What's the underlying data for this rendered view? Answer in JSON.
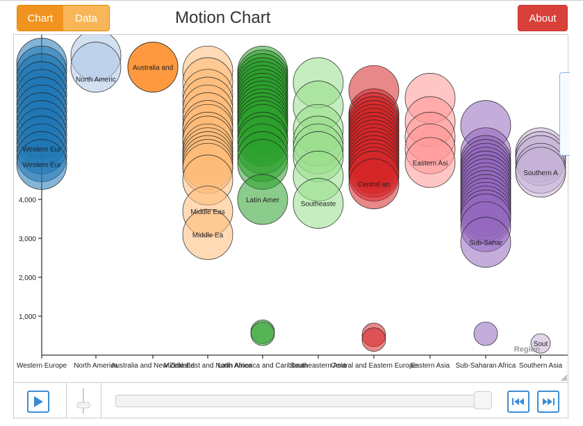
{
  "app": {
    "title": "Motion Chart",
    "tabs": [
      {
        "label": "Chart",
        "active": true
      },
      {
        "label": "Data",
        "active": false
      }
    ],
    "about_label": "About"
  },
  "chart_data": {
    "type": "scatter",
    "title": "",
    "xlabel": "Region",
    "ylabel": "",
    "categories": [
      "Western Europe",
      "North America",
      "Australia and New Zealand",
      "Middle East and North Africa",
      "Latin America and Caribbean",
      "Southeastern Asia",
      "Central and Eastern Europe",
      "Eastern Asia",
      "Sub-Saharan Africa",
      "Southern Asia"
    ],
    "yticks": [
      1000,
      2000,
      3000,
      4000
    ],
    "ylim": [
      0,
      5000
    ],
    "grid": false,
    "legend": "none",
    "colors": {
      "Western Europe": "#1f77b4",
      "North America": "#aec7e8",
      "Australia and New Zealand": "#ff7f0e",
      "Middle East and North Africa": "#ffbb78",
      "Latin America and Caribbean": "#2ca02c",
      "Southeastern Asia": "#98df8a",
      "Central and Eastern Europe": "#d62728",
      "Eastern Asia": "#ff9896",
      "Sub-Saharan Africa": "#9467bd",
      "Southern Asia": "#c5b0d5"
    },
    "series": [
      {
        "region": "Western Europe",
        "label": "Western Eur",
        "values": [
          7500,
          7300,
          7100,
          6900,
          6700,
          6500,
          6300,
          6100,
          5900,
          5700,
          5500,
          5300,
          5100,
          4900
        ]
      },
      {
        "region": "North America",
        "label": "North Americ",
        "values": [
          7700,
          7400
        ]
      },
      {
        "region": "Australia and New Zealand",
        "label": "Australia and",
        "values": [
          7400,
          7400
        ]
      },
      {
        "region": "Middle East and North Africa",
        "label": "Middle Ea",
        "values": [
          7300,
          7000,
          6700,
          6500,
          6300,
          6100,
          5900,
          5800,
          5600,
          5500,
          5300,
          5200,
          5100,
          5000,
          4900,
          4800,
          4500,
          3700,
          3100
        ]
      },
      {
        "region": "Latin America and Caribbean",
        "label": "Latin Amer",
        "values": [
          7300,
          7200,
          7100,
          7000,
          6900,
          6800,
          6700,
          6600,
          6500,
          6400,
          6300,
          6200,
          6100,
          6000,
          5900,
          5800,
          5600,
          5500,
          5300,
          5100,
          4900,
          4000,
          600,
          550
        ]
      },
      {
        "region": "Southeastern Asia",
        "label": "Southeaste",
        "values": [
          7000,
          6400,
          5800,
          5500,
          5300,
          5100,
          4600,
          3900
        ]
      },
      {
        "region": "Central and Eastern Europe",
        "label": "Central an",
        "values": [
          6800,
          6200,
          6100,
          6000,
          5900,
          5800,
          5700,
          5600,
          5500,
          5400,
          5300,
          5200,
          5100,
          5000,
          4900,
          4800,
          4700,
          4600,
          4400,
          520,
          400
        ]
      },
      {
        "region": "Eastern Asia",
        "label": "Eastern Asi",
        "values": [
          6600,
          6000,
          5600,
          5300,
          4950
        ]
      },
      {
        "region": "Sub-Saharan Africa",
        "label": "Sub-Sahar",
        "values": [
          5900,
          5200,
          5000,
          4900,
          4800,
          4700,
          4600,
          4500,
          4400,
          4300,
          4200,
          4100,
          4000,
          3900,
          3800,
          3700,
          3600,
          3500,
          3300,
          2900,
          550
        ]
      },
      {
        "region": "Southern Asia",
        "label": "Southern A",
        "values": [
          5200,
          5100,
          5000,
          4800,
          4700,
          300
        ]
      }
    ],
    "label_texts": {
      "Western Europe": [
        "Western Eur",
        "Western Eur"
      ],
      "North America": [
        "North Americ"
      ],
      "Australia and New Zealand": [
        "Australia and"
      ],
      "Middle East and North Africa": [
        "Middle Eas",
        "Middle Ea"
      ],
      "Latin America and Caribbean": [
        "Latin Amer"
      ],
      "Southeastern Asia": [
        "Southeaste"
      ],
      "Central and Eastern Europe": [
        "Central an"
      ],
      "Eastern Asia": [
        "Eastern Asi"
      ],
      "Sub-Saharan Africa": [
        "Sub-Sahar"
      ],
      "Southern Asia": [
        "Southern A",
        "Sout"
      ]
    }
  },
  "controls": {
    "play_icon": "play-icon",
    "speed_icon": "vertical-slider",
    "timeline_icon": "timeline-slider",
    "step_back_icon": "skip-back-icon",
    "step_forward_icon": "skip-forward-icon"
  }
}
